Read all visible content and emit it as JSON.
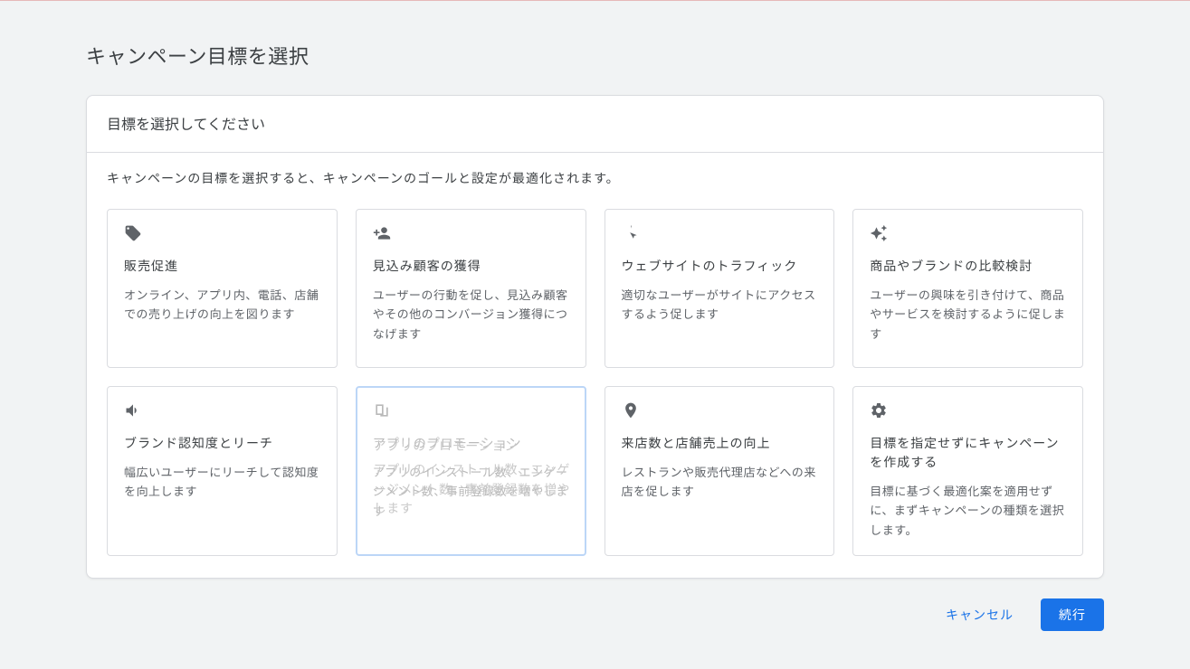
{
  "page_title": "キャンペーン目標を選択",
  "card": {
    "header": "目標を選択してください",
    "help_text": "キャンペーンの目標を選択すると、キャンペーンのゴールと設定が最適化されます。"
  },
  "goals": [
    {
      "icon": "tag",
      "title": "販売促進",
      "desc": "オンライン、アプリ内、電話、店舗での売り上げの向上を図ります"
    },
    {
      "icon": "person-plus",
      "title": "見込み顧客の獲得",
      "desc": "ユーザーの行動を促し、見込み顧客やその他のコンバージョン獲得につなげます"
    },
    {
      "icon": "click",
      "title": "ウェブサイトのトラフィック",
      "desc": "適切なユーザーがサイトにアクセスするよう促します"
    },
    {
      "icon": "sparkle",
      "title": "商品やブランドの比較検討",
      "desc": "ユーザーの興味を引き付けて、商品やサービスを検討するように促します"
    },
    {
      "icon": "megaphone",
      "title": "ブランド認知度とリーチ",
      "desc": "幅広いユーザーにリーチして認知度を向上します"
    },
    {
      "icon": "app",
      "title": "アプリのプロモーション",
      "desc": "アプリのインストール数、エンゲージメント数、事前登録数を増やします",
      "selected": true,
      "ghost1": "アプリのプロモーション",
      "ghost2": "アプリのインストール数、エンゲージメント数、事前登録数を増やします"
    },
    {
      "icon": "pin",
      "title": "来店数と店舗売上の向上",
      "desc": "レストランや販売代理店などへの来店を促します"
    },
    {
      "icon": "gear",
      "title": "目標を指定せずにキャンペーンを作成する",
      "desc": "目標に基づく最適化案を適用せずに、まずキャンペーンの種類を選択します。"
    }
  ],
  "buttons": {
    "cancel": "キャンセル",
    "continue": "続行"
  }
}
